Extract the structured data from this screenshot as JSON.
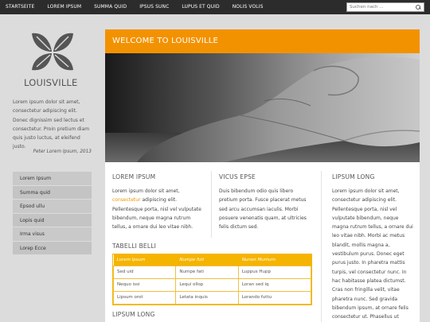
{
  "topnav": {
    "items": [
      "STARTSEITE",
      "LOREM IPSUM",
      "SUMMA QUID",
      "IPSUS SUNC",
      "LUPUS ET QUID",
      "NOLIS VOLIS"
    ],
    "search_placeholder": "Suchen nach ...",
    "search_icon": "search-icon"
  },
  "logo": {
    "text": "LOUISVILLE",
    "icon": "four-petal-logo"
  },
  "intro": {
    "text": "Lorem ipsum dolor sit amet, consectetur adipiscing elit. Donec dignissim sed lectus et consectetur. Proin pretium diam quis justo luctus, at eleifend justo.",
    "author": "Peter Lorem Ipsum, 2013"
  },
  "sidenav": {
    "items": [
      "Lorem Ipsum",
      "Summa quid",
      "Epsod ullu",
      "Lopis quid",
      "Irma visus",
      "Lorep Ecce"
    ]
  },
  "content": {
    "banner": "WELCOME TO LOUISVILLE",
    "col1": {
      "title": "LOREM IPSUM",
      "text_before": "Lorem ipsum dolor sit amet, ",
      "link": "consectetur",
      "text_after": " adipiscing elit. Pellentesque porta, nisl vel vulputate bibendum, neque magna rutrum tellus, a ornare dui leo vitae nibh."
    },
    "col2": {
      "title": "VICUS EPSE",
      "text": "Duis bibendum odio quis libero pretium porta. Fusce placerat metus sed arcu accumsan iaculis. Morbi posuere venenatis quam, at ultricies felis dictum sed."
    },
    "col3": {
      "title": "LIPSUM LONG",
      "text": "Lorem ipsum dolor sit amet, consectetur adipiscing elit. Pellentesque porta, nisl vel vulputate bibendum, neque magna rutrum tellus, a ornare dui leo vitae nibh. Morbi ac metus blandit, mollis magna a, vestibulum purus. Donec eget purus justo. In pharetra mattis turpis, vel consectetur nunc. In hac habitasse platea dictumst. Cras non fringilla velit, vitae pharetra nunc. Sed gravida bibendum ipsum, at ornare felis consectetur ut. Phasellus ut ipsum"
    },
    "table": {
      "title": "TABELLI BELLI",
      "headers": [
        "Lorem Ipsum",
        "Numpe futi",
        "Nunon Mumum"
      ],
      "rows": [
        [
          "Sed uid",
          "Numpe fati",
          "Luppus Hupp"
        ],
        [
          "Nequo issi",
          "Lequi ollop",
          "Loran sed iq"
        ],
        [
          "Lipsum orot",
          "Letata inquis",
          "Lorando futtu"
        ]
      ]
    },
    "bottom_title": "LIPSUM LONG"
  },
  "colors": {
    "accent": "#f39200",
    "table_header": "#f5b400",
    "topbar": "#2c2c2c"
  }
}
